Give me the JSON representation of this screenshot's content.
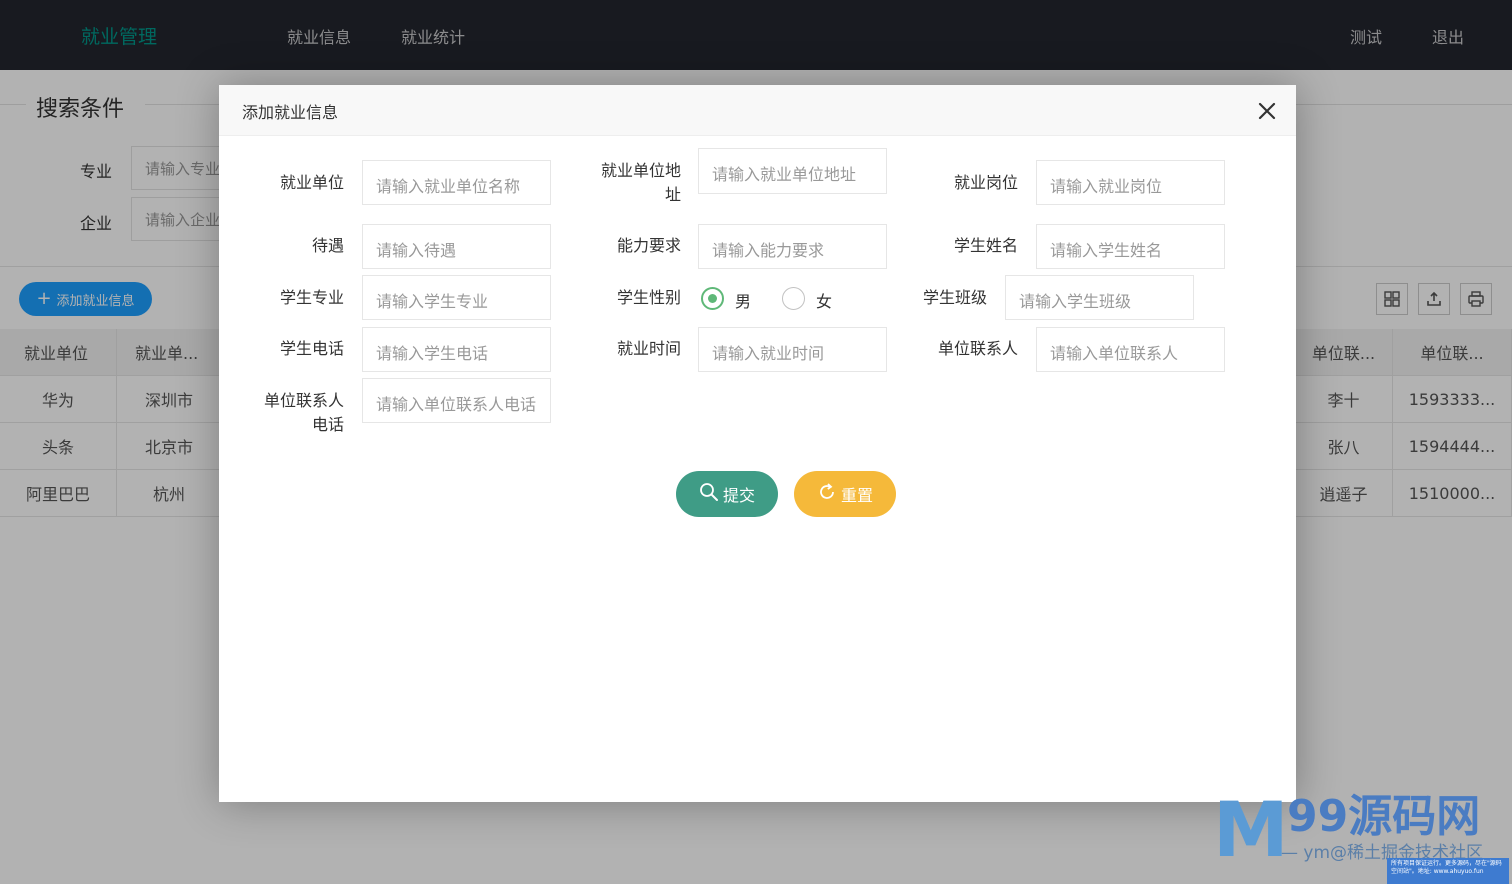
{
  "header": {
    "logo": "就业管理",
    "nav": [
      "就业信息",
      "就业统计"
    ],
    "right": [
      "测试",
      "退出"
    ]
  },
  "search": {
    "legend": "搜索条件",
    "major_label": "专业",
    "major_placeholder": "请输入专业",
    "company_label": "企业",
    "company_placeholder": "请输入企业"
  },
  "toolbar": {
    "add_label": "添加就业信息",
    "icons": [
      "columns-icon",
      "export-icon",
      "print-icon"
    ]
  },
  "table": {
    "left_headers": [
      "就业单位",
      "就业单..."
    ],
    "right_headers": [
      "单位联...",
      "单位联..."
    ],
    "rows": [
      {
        "unit": "华为",
        "address": "深圳市",
        "contact": "李十",
        "phone": "1593333..."
      },
      {
        "unit": "头条",
        "address": "北京市",
        "contact": "张八",
        "phone": "1594444..."
      },
      {
        "unit": "阿里巴巴",
        "address": "杭州",
        "contact": "逍遥子",
        "phone": "1510000..."
      }
    ]
  },
  "modal": {
    "title": "添加就业信息",
    "fields": {
      "unit_label": "就业单位",
      "unit_placeholder": "请输入就业单位名称",
      "address_label_1": "就业单位地",
      "address_label_2": "址",
      "address_placeholder": "请输入就业单位地址",
      "post_label": "就业岗位",
      "post_placeholder": "请输入就业岗位",
      "salary_label": "待遇",
      "salary_placeholder": "请输入待遇",
      "ability_label": "能力要求",
      "ability_placeholder": "请输入能力要求",
      "name_label": "学生姓名",
      "name_placeholder": "请输入学生姓名",
      "major_label": "学生专业",
      "major_placeholder": "请输入学生专业",
      "gender_label": "学生性别",
      "gender_male": "男",
      "gender_female": "女",
      "gender_selected": "男",
      "class_label": "学生班级",
      "class_placeholder": "请输入学生班级",
      "phone_label": "学生电话",
      "phone_placeholder": "请输入学生电话",
      "time_label": "就业时间",
      "time_placeholder": "请输入就业时间",
      "contact_label": "单位联系人",
      "contact_placeholder": "请输入单位联系人",
      "contact_phone_label_1": "单位联系人",
      "contact_phone_label_2": "电话",
      "contact_phone_placeholder": "请输入单位联系人电话"
    },
    "submit_label": "提交",
    "reset_label": "重置"
  },
  "watermark": {
    "brand": "99源码网",
    "sub": "— ym@稀土掘金技术社区",
    "note": "所有项目保证运行。更多源码，尽在\"源码空间站\"。地址: www.ahuyuo.fun"
  },
  "colors": {
    "header_bg": "#23262e",
    "logo": "#009688",
    "add_button": "#1e9fff",
    "submit_button": "#3f9c86",
    "reset_button": "#f5b93a",
    "radio_checked": "#5fb878"
  }
}
